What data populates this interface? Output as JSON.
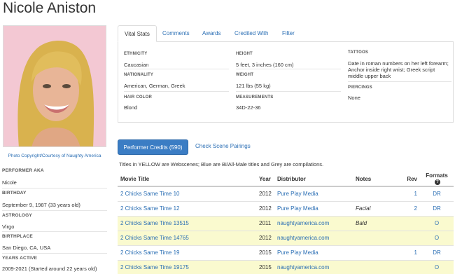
{
  "performer_name": "Nicole Aniston",
  "photo_credit": "Photo Copyright/Courtesy of Naughty America",
  "sidebar": {
    "aka_label": "PERFORMER AKA",
    "aka_value": "Nicole",
    "birthday_label": "BIRTHDAY",
    "birthday_date": "September 9, 1987",
    "birthday_age": "(33 years old)",
    "astrology_label": "ASTROLOGY",
    "astrology_value": "Virgo",
    "birthplace_label": "BIRTHPLACE",
    "birthplace_value": "San Diego, CA, USA",
    "years_active_label": "YEARS ACTIVE",
    "years_active_value": "2009-2021 (Started around 22 years old)"
  },
  "tabs": [
    "Vital Stats",
    "Comments",
    "Awards",
    "Credited With",
    "Filter"
  ],
  "vital_stats": {
    "ethnicity_label": "ETHNICITY",
    "ethnicity_value": "Caucasian",
    "nationality_label": "NATIONALITY",
    "nationality_value": "American, German, Greek",
    "hair_label": "HAIR COLOR",
    "hair_value": "Blond",
    "height_label": "HEIGHT",
    "height_value": "5 feet, 3 inches (160 cm)",
    "weight_label": "WEIGHT",
    "weight_value": "121 lbs (55 kg)",
    "measurements_label": "MEASUREMENTS",
    "measurements_value": "34D-22-36",
    "tattoos_label": "TATTOOS",
    "tattoos_value": "Date in roman numbers on her left forearm; Anchor inside right wrist; Greek script middle upper back",
    "piercings_label": "PIERCINGS",
    "piercings_value": "None"
  },
  "credits_button": "Performer Credits (590)",
  "check_pairings": "Check Scene Pairings",
  "legend": "Titles in YELLOW are Webscenes; Blue are Bi/All-Male titles and Grey are compilations.",
  "table": {
    "headers": [
      "Movie Title",
      "Year",
      "Distributor",
      "Notes",
      "Rev",
      "Formats"
    ],
    "help_icon": "?",
    "rows": [
      {
        "title": "2 Chicks Same Time 10",
        "year": "2012",
        "distributor": "Pure Play Media",
        "notes": "",
        "rev": "1",
        "formats": "DR",
        "web": false
      },
      {
        "title": "2 Chicks Same Time 12",
        "year": "2012",
        "distributor": "Pure Play Media",
        "notes": "Facial",
        "rev": "2",
        "formats": "DR",
        "web": false
      },
      {
        "title": "2 Chicks Same Time 13515",
        "year": "2011",
        "distributor": "naughtyamerica.com",
        "notes": "Bald",
        "rev": "",
        "formats": "O",
        "web": true
      },
      {
        "title": "2 Chicks Same Time 14765",
        "year": "2012",
        "distributor": "naughtyamerica.com",
        "notes": "",
        "rev": "",
        "formats": "O",
        "web": true
      },
      {
        "title": "2 Chicks Same Time 19",
        "year": "2015",
        "distributor": "Pure Play Media",
        "notes": "",
        "rev": "1",
        "formats": "DR",
        "web": false
      },
      {
        "title": "2 Chicks Same Time 19175",
        "year": "2015",
        "distributor": "naughtyamerica.com",
        "notes": "",
        "rev": "",
        "formats": "O",
        "web": true
      }
    ]
  }
}
